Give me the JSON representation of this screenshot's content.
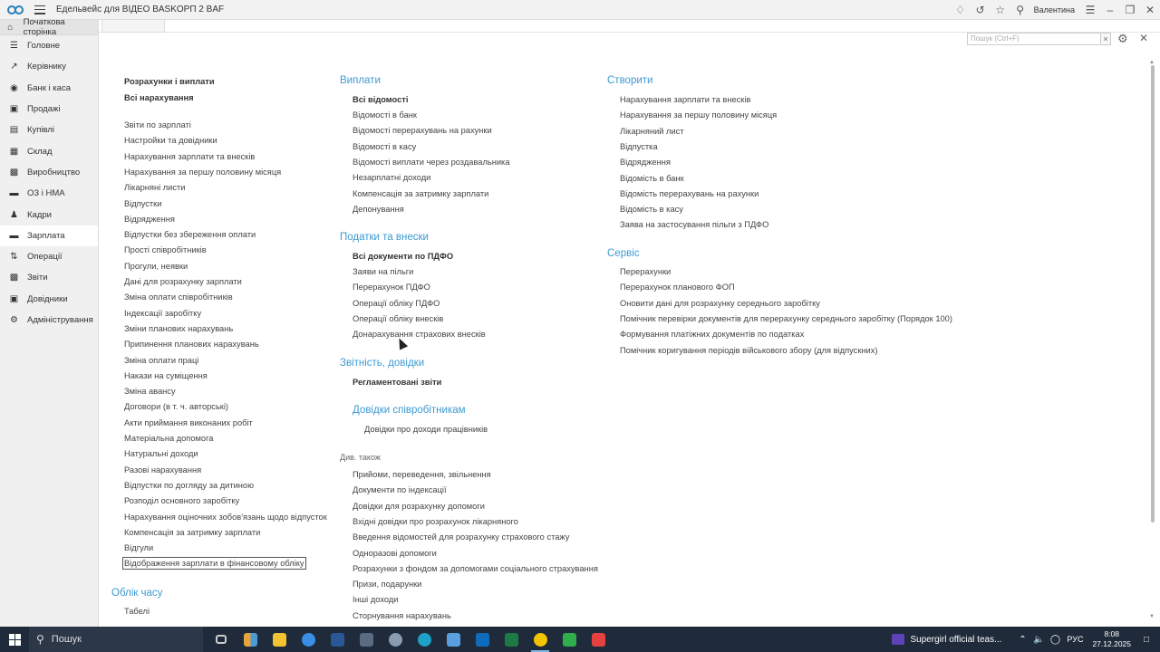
{
  "app": {
    "title": "Едельвейс для ВІДЕО BASKOРП 2 BAF",
    "user": "Валентина"
  },
  "sidebar": {
    "home": "Початкова сторінка",
    "items": [
      {
        "label": "Головне",
        "icon": "list-icon"
      },
      {
        "label": "Керівнику",
        "icon": "chart-line-icon"
      },
      {
        "label": "Банк і каса",
        "icon": "bank-icon"
      },
      {
        "label": "Продажі",
        "icon": "bag-icon"
      },
      {
        "label": "Купівлі",
        "icon": "cart-icon"
      },
      {
        "label": "Склад",
        "icon": "warehouse-icon"
      },
      {
        "label": "Виробництво",
        "icon": "factory-icon"
      },
      {
        "label": "ОЗ і НМА",
        "icon": "truck-icon"
      },
      {
        "label": "Кадри",
        "icon": "person-icon"
      },
      {
        "label": "Зарплата",
        "icon": "salary-icon"
      },
      {
        "label": "Операції",
        "icon": "operations-icon"
      },
      {
        "label": "Звіти",
        "icon": "reports-icon"
      },
      {
        "label": "Довідники",
        "icon": "book-icon"
      },
      {
        "label": "Адміністрування",
        "icon": "gear-icon"
      }
    ],
    "active": "Зарплата"
  },
  "search": {
    "placeholder": "Пошук (Ctrl+F)",
    "clear": "×"
  },
  "col1": {
    "heading1": "Розрахунки і виплати",
    "heading2": "Всі нарахування",
    "items": [
      "Звіти по зарплаті",
      "Настройки та довідники",
      "Нарахування зарплати та внесків",
      "Нарахування за першу половину місяця",
      "Лікарняні листи",
      "Відпустки",
      "Відрядження",
      "Відпустки без збереження оплати",
      "Прості співробітників",
      "Прогули, неявки",
      "Дані для розрахунку зарплати",
      "Зміна оплати співробітників",
      "Індексації заробітку",
      "Зміни планових нарахувань",
      "Припинення планових нарахувань",
      "Зміна оплати праці",
      "Накази на суміщення",
      "Зміна авансу",
      "Договори (в т. ч. авторські)",
      "Акти приймання виконаних робіт",
      "Матеріальна допомога",
      "Натуральні доходи",
      "Разові нарахування",
      "Відпустки по догляду за дитиною",
      "Розподіл основного заробітку",
      "Нарахування оціночних зобов'язань щодо відпусток",
      "Компенсація за затримку зарплати",
      "Відгули",
      "Відображення зарплати в фінансовому обліку"
    ],
    "time_heading": "Облік часу",
    "time_items": [
      "Табелі"
    ]
  },
  "col2": {
    "payouts": {
      "heading": "Виплати",
      "bold": "Всі відомості",
      "items": [
        "Відомості в банк",
        "Відомості перерахувань на рахунки",
        "Відомості в касу",
        "Відомості виплати через роздавальника",
        "Незарплатні доходи",
        "Компенсація за затримку зарплати",
        "Депонування"
      ]
    },
    "taxes": {
      "heading": "Податки та внески",
      "bold": "Всі документи по ПДФО",
      "items": [
        "Заяви на пільги",
        "Перерахунок ПДФО",
        "Операції обліку ПДФО",
        "Операції обліку внесків",
        "Донарахування страхових внесків"
      ]
    },
    "reporting": {
      "heading": "Звітність, довідки",
      "bold": "Регламентовані звіти",
      "subheading": "Довідки співробітникам",
      "subitem": "Довідки про доходи працівників"
    },
    "see_also": {
      "label": "Див. також",
      "items": [
        "Прийоми, переведення, звільнення",
        "Документи по індексації",
        "Довідки для розрахунку допомоги",
        "Вхідні довідки про розрахунок лікарняного",
        "Введення відомостей для розрахунку страхового стажу",
        "Одноразові допомоги",
        "Розрахунки з фондом за допомогами соціального страхування",
        "Призи, подарунки",
        "Інші доходи",
        "Сторнування нарахувань"
      ]
    }
  },
  "col3": {
    "create": {
      "heading": "Створити",
      "items": [
        "Нарахування зарплати та внесків",
        "Нарахування за першу половину місяця",
        "Лікарняний лист",
        "Відпустка",
        "Відрядження",
        "Відомість в банк",
        "Відомість перерахувань на рахунки",
        "Відомість в касу",
        "Заява на застосування пільги з ПДФО"
      ]
    },
    "service": {
      "heading": "Сервіс",
      "items": [
        "Перерахунки",
        "Перерахунок планового ФОП",
        "Оновити дані для розрахунку середнього заробітку",
        "Помічник перевірки документів для перерахунку середнього заробітку (Порядок 100)",
        "Формування платіжних документів по податках",
        "Помічник коригування періодів військового збору (для відпускних)"
      ]
    }
  },
  "taskbar": {
    "search": "Пошук",
    "notification": "Supergirl official teas...",
    "lang": "РУС",
    "time": "8:08",
    "date": "27.12.2025"
  }
}
